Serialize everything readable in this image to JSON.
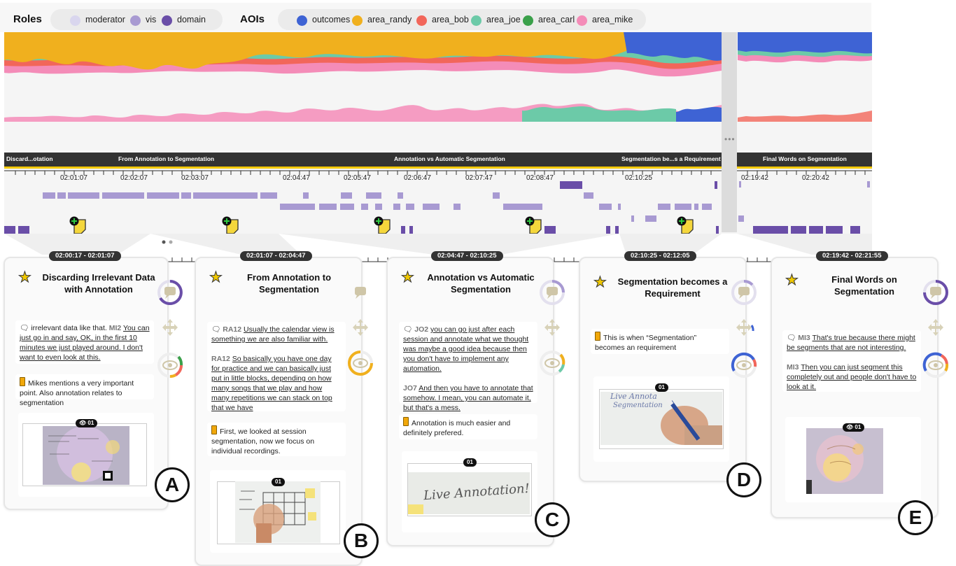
{
  "legend": {
    "roles_title": "Roles",
    "roles": [
      {
        "label": "moderator",
        "color": "#d9d6ee"
      },
      {
        "label": "vis",
        "color": "#a89ad2"
      },
      {
        "label": "domain",
        "color": "#6a4ea8"
      }
    ],
    "aois_title": "AOIs",
    "aois": [
      {
        "label": "outcomes",
        "color": "#3e63d4"
      },
      {
        "label": "area_randy",
        "color": "#f0b01e"
      },
      {
        "label": "area_bob",
        "color": "#f2665a"
      },
      {
        "label": "area_joe",
        "color": "#6ccaa8"
      },
      {
        "label": "area_carl",
        "color": "#3aa04a"
      },
      {
        "label": "area_mike",
        "color": "#f48cb8"
      }
    ]
  },
  "timeline": {
    "segments": [
      {
        "label": "Discard...otation"
      },
      {
        "label": "From Annotation to Segmentation"
      },
      {
        "label": "Annotation vs Automatic Segmentation"
      },
      {
        "label": "Segmentation be...s a Requirement"
      },
      {
        "label": "Final Words on Segmentation"
      }
    ],
    "ticks": [
      "02:01:07",
      "02:02:07",
      "02:03:07",
      "02:04:47",
      "02:05:47",
      "02:06:47",
      "02:07:47",
      "02:08:47",
      "02:10:25",
      "02:19:42",
      "02:20:42"
    ]
  },
  "cards": [
    {
      "time": "02:00:17 - 02:01:07",
      "title_l1": "Discarding Irrelevant Data",
      "title_l2": "with Annotation",
      "note1_pre": "irrelevant data like that.",
      "note1_spk": "MI2",
      "note1_text": "You can just go in and say, OK, in the first 10 minutes we just played around. I don't want to even look at this.",
      "note2": "Mikes mentions a very important point. Also annotation relates to segmentation",
      "badge": "01",
      "letter": "A"
    },
    {
      "time": "02:01:07 - 02:04:47",
      "title_l1": "From Annotation to",
      "title_l2": "Segmentation",
      "note1_spk1": "RA12",
      "note1_text1": "Usually the calendar view is something we are also familiar with.",
      "note1_spk2": "RA12",
      "note1_text2": "So basically you have one day for practice and we can basically just put in little blocks, depending on how many songs that we play and how many repetitions we can stack on top that we have",
      "note2": "First, we looked at session segmentation, now we focus on individual recordings.",
      "badge": "01",
      "letter": "B"
    },
    {
      "time": "02:04:47 - 02:10:25",
      "title_l1": "Annotation vs Automatic",
      "title_l2": "Segmentation",
      "note1_spk1": "JO2",
      "note1_text1": "you can go just after each session and annotate what we thought was maybe a good idea because then you don't have to implement any automation.",
      "note1_spk2": "JO7",
      "note1_text2": "And then you have to annotate that somehow. I mean, you can automate it, but that's a mess.",
      "note2": "Annotation is much easier and definitely prefered.",
      "badge": "01",
      "thumb_text": "Live Annotation!",
      "letter": "C"
    },
    {
      "time": "02:10:25 - 02:12:05",
      "title_l1": "Segmentation becomes a",
      "title_l2": "Requirement",
      "note1": "This is when “Segmentation” becomes an requirement",
      "badge": "01",
      "thumb_text": "Live Annota",
      "thumb_text2": "Segmentation",
      "letter": "D"
    },
    {
      "time": "02:19:42 - 02:21:55",
      "title_l1": "Final Words on",
      "title_l2": "Segmentation",
      "note1_spk1": "MI3",
      "note1_text1": "That's true because there might be segments that are not interesting.",
      "note1_spk2": "MI3",
      "note1_text2": "Then you can just segment this completely out and people don't have to look at it.",
      "badge": "01",
      "letter": "E"
    }
  ]
}
